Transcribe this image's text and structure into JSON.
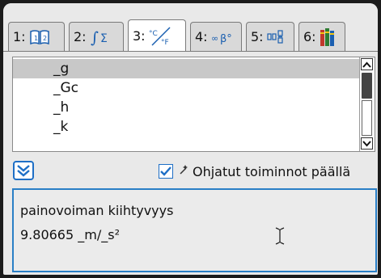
{
  "tabs": [
    {
      "num": "1:",
      "icon": "book-icon"
    },
    {
      "num": "2:",
      "icon": "calculus-icon"
    },
    {
      "num": "3:",
      "icon": "units-icon"
    },
    {
      "num": "4:",
      "icon": "symbols-icon"
    },
    {
      "num": "5:",
      "icon": "templates-icon"
    },
    {
      "num": "6:",
      "icon": "library-icon"
    }
  ],
  "active_tab": "3:",
  "list": {
    "items": [
      "_g",
      "_Gc",
      "_h",
      "_k"
    ],
    "selected": "_g"
  },
  "option": {
    "checked": true,
    "label": "Ohjatut toiminnot päällä"
  },
  "info": {
    "description": "painovoiman kiihtyvyys",
    "value": "9.80665 _m/_s²"
  },
  "colors": {
    "accent": "#1e6fc6",
    "selection": "#c8c8c8"
  }
}
